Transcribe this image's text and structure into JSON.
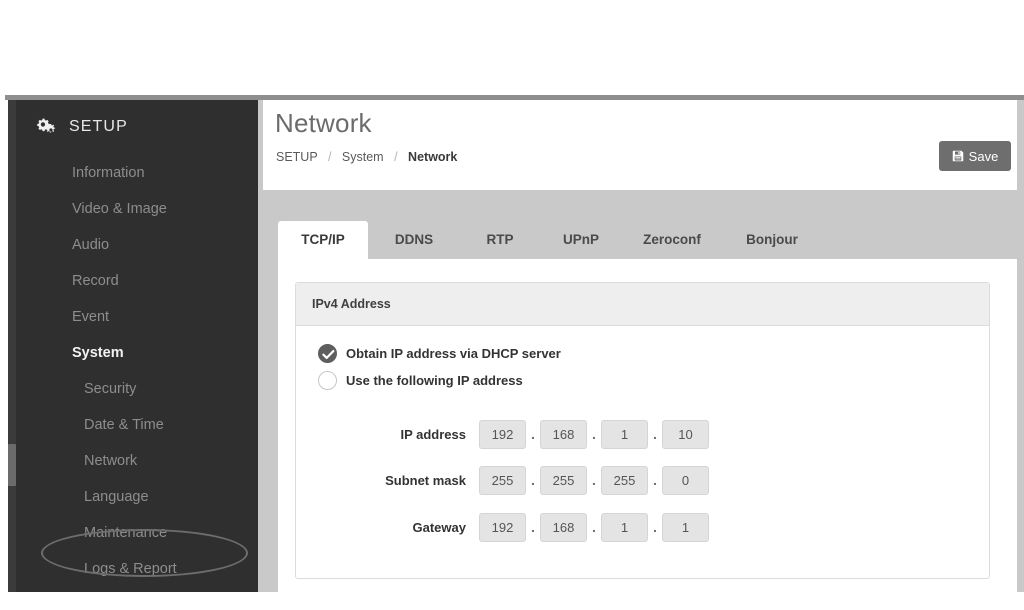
{
  "sidebar": {
    "brand": {
      "label": "SETUP",
      "icon": "gears-icon"
    },
    "items": [
      {
        "label": "Information",
        "level": 1,
        "state": "normal"
      },
      {
        "label": "Video & Image",
        "level": 1,
        "state": "normal"
      },
      {
        "label": "Audio",
        "level": 1,
        "state": "normal"
      },
      {
        "label": "Record",
        "level": 1,
        "state": "normal"
      },
      {
        "label": "Event",
        "level": 1,
        "state": "normal"
      },
      {
        "label": "System",
        "level": 1,
        "state": "active"
      },
      {
        "label": "Security",
        "level": 2,
        "state": "normal"
      },
      {
        "label": "Date & Time",
        "level": 2,
        "state": "normal"
      },
      {
        "label": "Network",
        "level": 2,
        "state": "highlighted"
      },
      {
        "label": "Language",
        "level": 2,
        "state": "normal"
      },
      {
        "label": "Maintenance",
        "level": 2,
        "state": "normal"
      },
      {
        "label": "Logs & Report",
        "level": 2,
        "state": "normal"
      }
    ]
  },
  "header": {
    "title": "Network",
    "breadcrumb": [
      {
        "label": "SETUP",
        "current": false
      },
      {
        "label": "System",
        "current": false
      },
      {
        "label": "Network",
        "current": true
      }
    ],
    "separator": "/",
    "save_button": {
      "label": "Save",
      "icon": "floppy-disk-icon"
    }
  },
  "tabs": [
    {
      "label": "TCP/IP",
      "active": true
    },
    {
      "label": "DDNS",
      "active": false
    },
    {
      "label": "RTP",
      "active": false
    },
    {
      "label": "UPnP",
      "active": false
    },
    {
      "label": "Zeroconf",
      "active": false
    },
    {
      "label": "Bonjour",
      "active": false
    }
  ],
  "ipv4_card": {
    "title": "IPv4 Address",
    "radios": [
      {
        "label": "Obtain IP address via DHCP server",
        "checked": true
      },
      {
        "label": "Use the following IP address",
        "checked": false
      }
    ],
    "fields": [
      {
        "label": "IP address",
        "octets": [
          "192",
          "168",
          "1",
          "10"
        ]
      },
      {
        "label": "Subnet mask",
        "octets": [
          "255",
          "255",
          "255",
          "0"
        ]
      },
      {
        "label": "Gateway",
        "octets": [
          "192",
          "168",
          "1",
          "1"
        ]
      }
    ],
    "octet_separator": "."
  },
  "annotation": {
    "type": "ellipse-highlight",
    "target": "Network",
    "color": "#6d6d6d"
  },
  "colors": {
    "sidebar_bg": "#2f2f2f",
    "content_bg": "#c9c9c9",
    "panel_bg": "#ffffff",
    "accent_button": "#6e6e6e",
    "radio_checked": "#5e5e5e",
    "field_bg": "#e4e4e4"
  }
}
